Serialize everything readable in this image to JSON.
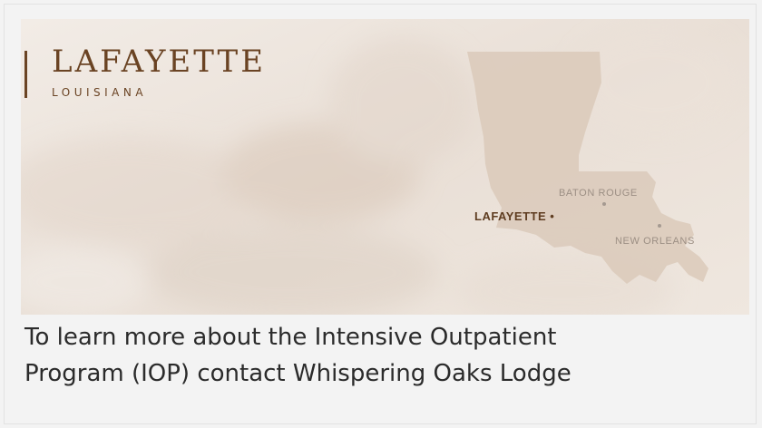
{
  "brand": {
    "title": "LAFAYETTE",
    "subtitle": "LOUISIANA",
    "color": "#6a4323"
  },
  "map": {
    "region": "Louisiana",
    "cities": [
      {
        "name": "LAFAYETTE",
        "highlighted": true
      },
      {
        "name": "BATON ROUGE",
        "highlighted": false
      },
      {
        "name": "NEW ORLEANS",
        "highlighted": false
      }
    ],
    "marker": "•"
  },
  "caption": {
    "line1": "To learn more about the Intensive Outpatient",
    "line2": "Program (IOP) contact Whispering Oaks Lodge"
  }
}
